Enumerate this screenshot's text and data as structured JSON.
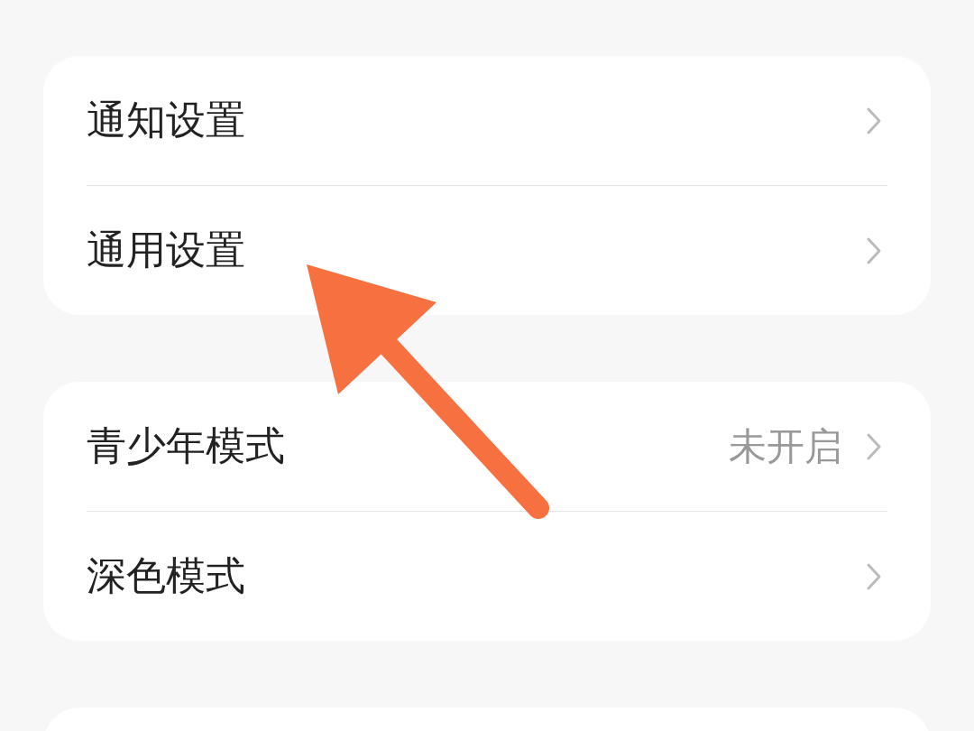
{
  "sections": [
    {
      "rows": [
        {
          "label": "通知设置"
        },
        {
          "label": "通用设置"
        }
      ]
    },
    {
      "rows": [
        {
          "label": "青少年模式",
          "value": "未开启"
        },
        {
          "label": "深色模式"
        }
      ]
    }
  ]
}
